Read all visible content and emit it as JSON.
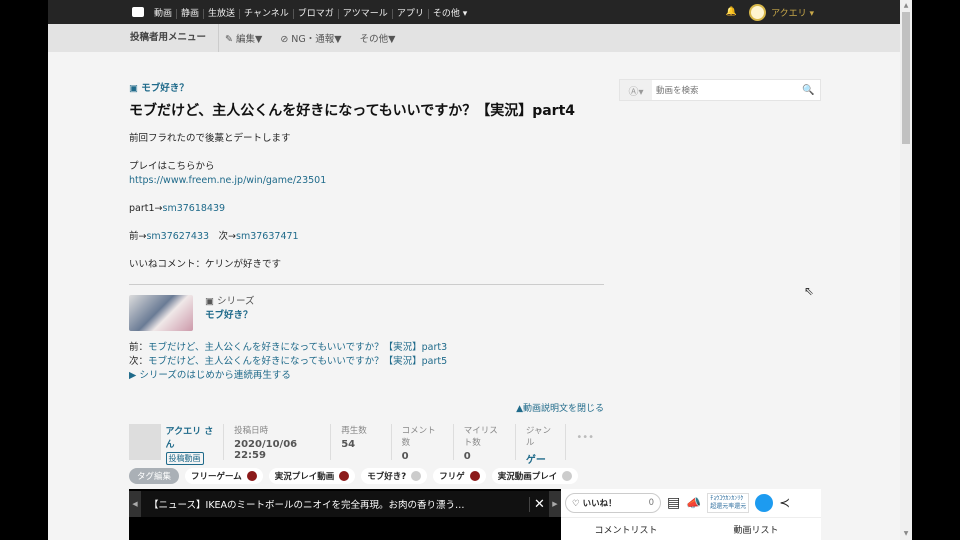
{
  "topbar": {
    "nav": [
      "動画",
      "静画",
      "生放送",
      "チャンネル",
      "ブロマガ",
      "アツマール",
      "アプリ",
      "その他 ▾"
    ],
    "username": "アクエリ ▾"
  },
  "subbar": {
    "menu": "投稿者用メニュー",
    "edit": "✎ 編集▼",
    "ng": "⊘ NG・通報▼",
    "other": "その他▼"
  },
  "search": {
    "placeholder": "動画を検索"
  },
  "video": {
    "series_tag": "モブ好き？",
    "title": "モブだけど、主人公くんを好きになってもいいですか？【実況】part4",
    "desc_line1": "前回フラれたので後藁とデートします",
    "desc_line2": "プレイはこちらから",
    "desc_url": "https://www.freem.ne.jp/win/game/23501",
    "part1_label": "part1→",
    "part1_link": "sm37618439",
    "prev_label": "前→",
    "prev_link": "sm37627433",
    "next_label": "次→",
    "next_link": "sm37637471",
    "desc_last": "いいねコメント：ケリンが好きです"
  },
  "series": {
    "label": "シリーズ",
    "name": "モブ好き？",
    "prev_label": "前：",
    "prev": "モブだけど、主人公くんを好きになってもいいですか？【実況】part3",
    "next_label": "次：",
    "next": "モブだけど、主人公くんを好きになってもいいですか？【実況】part5",
    "play_all": "▶ シリーズのはじめから連続再生する"
  },
  "close_desc": "▲動画説明文を閉じる",
  "meta": {
    "owner": "アクエリ さん",
    "owner_badge": "投稿動画",
    "stats": [
      {
        "label": "投稿日時",
        "value": "2020/10/06 22:59"
      },
      {
        "label": "再生数",
        "value": "54"
      },
      {
        "label": "コメント数",
        "value": "0"
      },
      {
        "label": "マイリスト数",
        "value": "0"
      },
      {
        "label": "ジャンル",
        "value": "ゲーム"
      }
    ]
  },
  "tags": {
    "edit": "タグ編集",
    "items": [
      {
        "name": "フリーゲーム",
        "locked": true
      },
      {
        "name": "実況プレイ動画",
        "locked": true
      },
      {
        "name": "モブ好き?",
        "locked": false
      },
      {
        "name": "フリゲ",
        "locked": true
      },
      {
        "name": "実況動画プレイ",
        "locked": false
      }
    ]
  },
  "ticker": {
    "text": "【ニュース】IKEAのミートボールのニオイを完全再現。お肉の香り漂う…"
  },
  "panel": {
    "like": "♡ いいね！",
    "like_count": "0",
    "uad_line1": "ﾁｮｳｺｳｶﾝｶﾝﾘｸ",
    "uad_line2": "超還元率還元",
    "tab_comments": "コメントリスト",
    "tab_videos": "動画リスト"
  }
}
